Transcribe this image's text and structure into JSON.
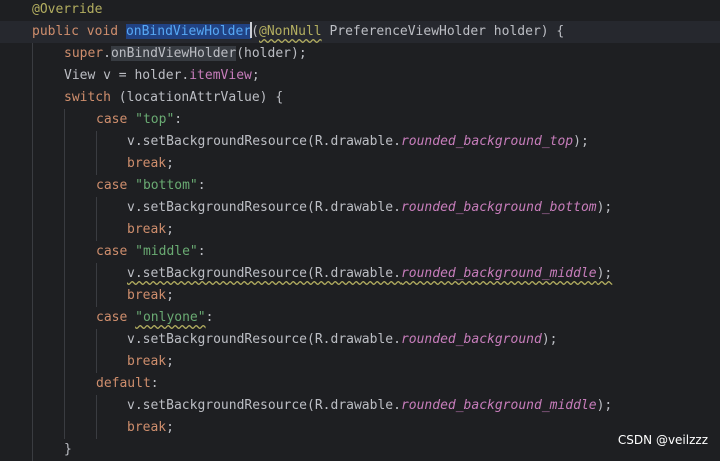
{
  "editor": {
    "lines": [
      [
        {
          "t": "@Override",
          "c": "ann"
        }
      ],
      [
        {
          "t": "public",
          "c": "kw"
        },
        {
          "t": " "
        },
        {
          "t": "void",
          "c": "kw"
        },
        {
          "t": " "
        },
        {
          "t": "onBindViewHolder",
          "c": "fn sel"
        },
        {
          "caret": true
        },
        {
          "t": "("
        },
        {
          "t": "@NonNull",
          "c": "ann squig"
        },
        {
          "t": " PreferenceViewHolder holder) {"
        }
      ],
      [
        {
          "t": "super",
          "c": "kw"
        },
        {
          "t": "."
        },
        {
          "t": "onBindViewHolder",
          "c": "usage"
        },
        {
          "t": "(holder);"
        }
      ],
      [
        {
          "t": "View v = holder."
        },
        {
          "t": "itemView",
          "c": "fld"
        },
        {
          "t": ";"
        }
      ],
      [
        {
          "t": "switch",
          "c": "kw"
        },
        {
          "t": " (locationAttrValue) {"
        }
      ],
      [
        {
          "t": "case",
          "c": "kw"
        },
        {
          "t": " "
        },
        {
          "t": "\"top\"",
          "c": "str"
        },
        {
          "t": ":"
        }
      ],
      [
        {
          "t": "v.setBackgroundResource(R.drawable."
        },
        {
          "t": "rounded_background_top",
          "c": "sfld"
        },
        {
          "t": ");"
        }
      ],
      [
        {
          "t": "break",
          "c": "kw"
        },
        {
          "t": ";"
        }
      ],
      [
        {
          "t": "case",
          "c": "kw"
        },
        {
          "t": " "
        },
        {
          "t": "\"bottom\"",
          "c": "str"
        },
        {
          "t": ":"
        }
      ],
      [
        {
          "t": "v.setBackgroundResource(R.drawable."
        },
        {
          "t": "rounded_background_bottom",
          "c": "sfld"
        },
        {
          "t": ");"
        }
      ],
      [
        {
          "t": "break",
          "c": "kw"
        },
        {
          "t": ";"
        }
      ],
      [
        {
          "t": "case",
          "c": "kw"
        },
        {
          "t": " "
        },
        {
          "t": "\"middle\"",
          "c": "str"
        },
        {
          "t": ":"
        }
      ],
      [
        {
          "t": "v.setBackgroundResource(R.drawable.",
          "c": "squig"
        },
        {
          "t": "rounded_background_middle",
          "c": "sfld squig"
        },
        {
          "t": ");",
          "c": "squig"
        }
      ],
      [
        {
          "t": "break",
          "c": "kw"
        },
        {
          "t": ";"
        }
      ],
      [
        {
          "t": "case",
          "c": "kw"
        },
        {
          "t": " "
        },
        {
          "t": "\"onlyone\"",
          "c": "str squig"
        },
        {
          "t": ":"
        }
      ],
      [
        {
          "t": "v.setBackgroundResource(R.drawable."
        },
        {
          "t": "rounded_background",
          "c": "sfld"
        },
        {
          "t": ");"
        }
      ],
      [
        {
          "t": "break",
          "c": "kw"
        },
        {
          "t": ";"
        }
      ],
      [
        {
          "t": "default",
          "c": "kw"
        },
        {
          "t": ":"
        }
      ],
      [
        {
          "t": "v.setBackgroundResource(R.drawable."
        },
        {
          "t": "rounded_background_middle",
          "c": "sfld"
        },
        {
          "t": ");"
        }
      ],
      [
        {
          "t": "break",
          "c": "kw"
        },
        {
          "t": ";"
        }
      ],
      [
        {
          "t": "}"
        }
      ]
    ]
  },
  "watermark": "CSDN @veilzzz"
}
